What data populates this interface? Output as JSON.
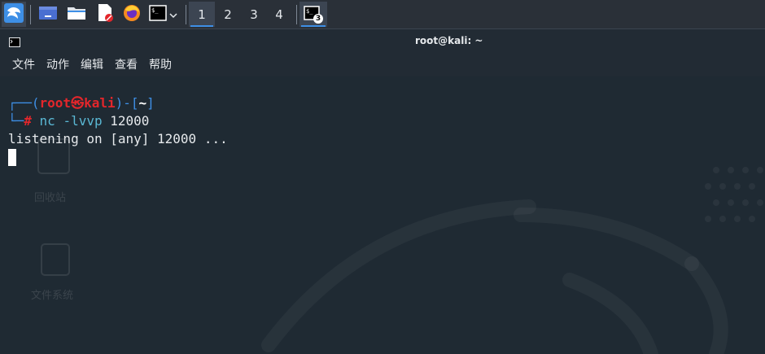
{
  "taskbar": {
    "workspaces": [
      "1",
      "2",
      "3",
      "4"
    ],
    "active_workspace": "1",
    "terminal_badge": "3",
    "apps": [
      "kali-menu-icon",
      "show-desktop-icon",
      "file-manager-icon",
      "text-editor-icon",
      "firefox-icon",
      "terminal-icon"
    ]
  },
  "window": {
    "title": "root@kali: ~"
  },
  "menu": [
    "文件",
    "动作",
    "编辑",
    "查看",
    "帮助"
  ],
  "terminal": {
    "prompt_open": "┌──(",
    "user": "root",
    "at_symbol": "㉿",
    "host": "kali",
    "prompt_mid": ")-[",
    "cwd": "~",
    "prompt_close": "]",
    "prompt_corner": "└─",
    "hash": "#",
    "cmd_name": "nc",
    "cmd_args": "-lvvp",
    "cmd_port": "12000",
    "output": "listening on [any] 12000 ..."
  },
  "desktop_ghost": {
    "trash_label": "回收站",
    "filesystem_label": "文件系统"
  },
  "colors": {
    "prompt_frame": "#3e8fe6",
    "user_host": "#e3262b",
    "command": "#5ab8d4",
    "background": "#1f2a33"
  }
}
